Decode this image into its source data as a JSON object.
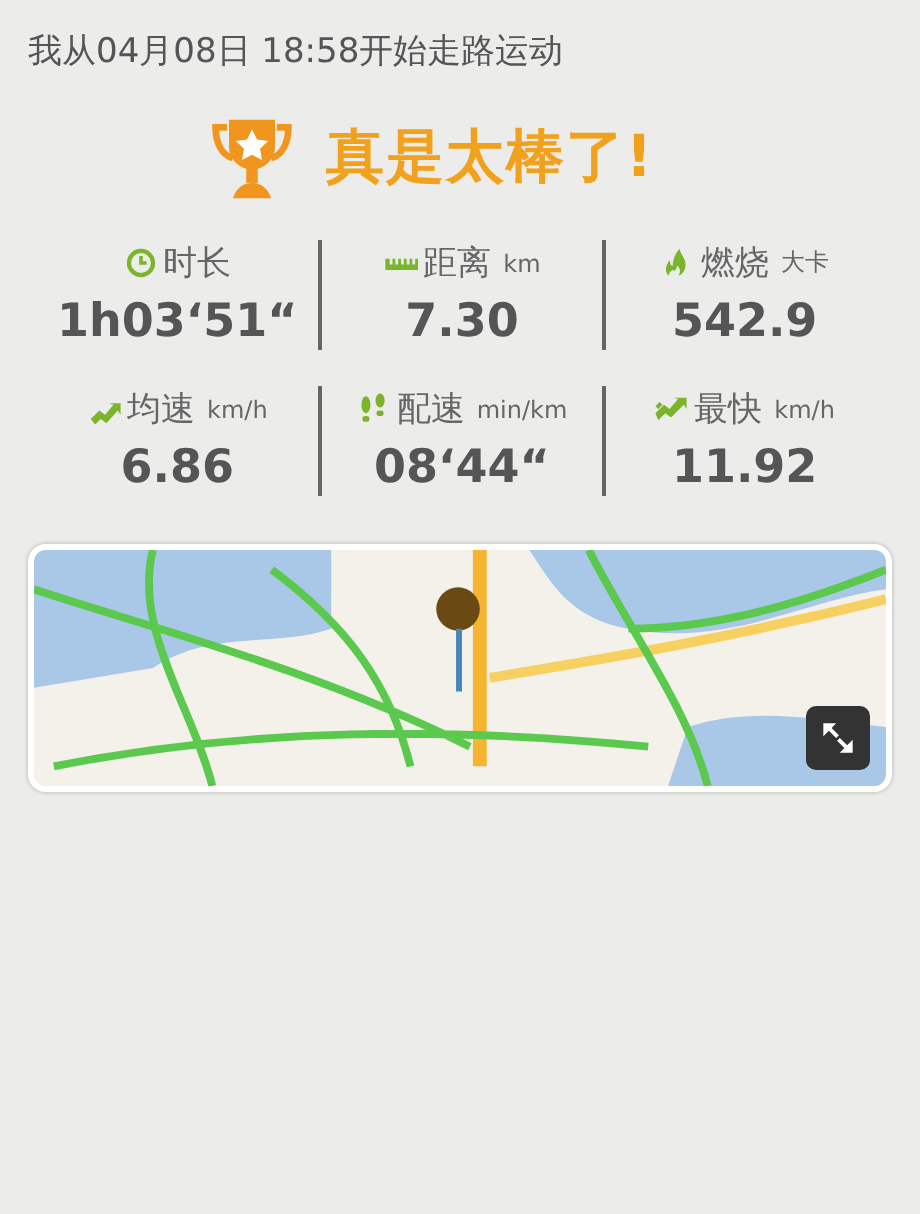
{
  "header": "我从04月08日 18:58开始走路运动",
  "title": "真是太棒了!",
  "stats": [
    {
      "kind": "duration",
      "label": "时长",
      "value": "1h03‘51“"
    },
    {
      "kind": "distance",
      "label": "距离",
      "unit": "km",
      "value": "7.30"
    },
    {
      "kind": "calories",
      "label": "燃烧",
      "unit": "大卡",
      "value": "542.9"
    },
    {
      "kind": "avg_speed",
      "label": "均速",
      "unit": "km/h",
      "value": "6.86"
    },
    {
      "kind": "pace",
      "label": "配速",
      "unit": "min/km",
      "value": "08‘44“"
    },
    {
      "kind": "max_speed",
      "label": "最快",
      "unit": "km/h",
      "value": "11.92"
    }
  ]
}
